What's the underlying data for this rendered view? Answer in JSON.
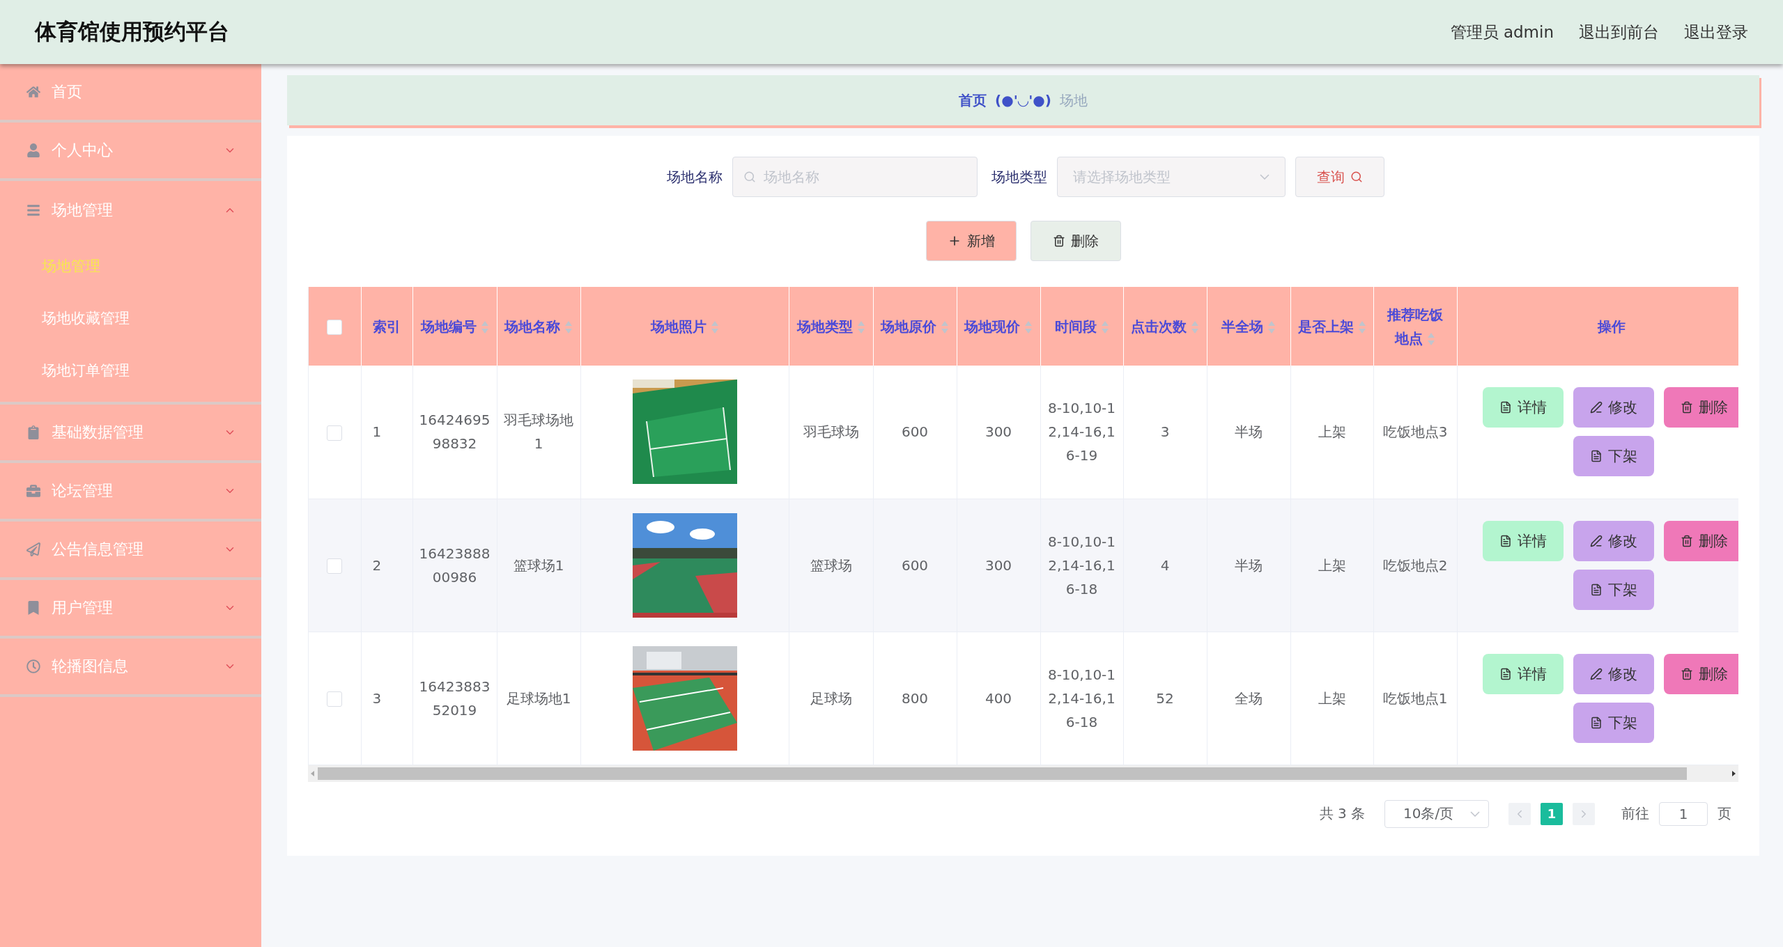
{
  "header": {
    "title": "体育馆使用预约平台",
    "user": "管理员 admin",
    "links": [
      "退出到前台",
      "退出登录"
    ]
  },
  "sidebar": {
    "items": [
      {
        "label": "首页",
        "expandable": false
      },
      {
        "label": "个人中心",
        "expandable": true,
        "expanded": false
      },
      {
        "label": "场地管理",
        "expandable": true,
        "expanded": true,
        "children": [
          {
            "label": "场地管理",
            "selected": true
          },
          {
            "label": "场地收藏管理",
            "selected": false
          },
          {
            "label": "场地订单管理",
            "selected": false
          }
        ]
      },
      {
        "label": "基础数据管理",
        "expandable": true,
        "expanded": false
      },
      {
        "label": "论坛管理",
        "expandable": true,
        "expanded": false
      },
      {
        "label": "公告信息管理",
        "expandable": true,
        "expanded": false
      },
      {
        "label": "用户管理",
        "expandable": true,
        "expanded": false
      },
      {
        "label": "轮播图信息",
        "expandable": true,
        "expanded": false
      }
    ]
  },
  "breadcrumb": {
    "home": "首页",
    "separator": "(●'◡'●)",
    "current": "场地"
  },
  "search": {
    "name_label": "场地名称",
    "name_placeholder": "场地名称",
    "type_label": "场地类型",
    "type_placeholder": "请选择场地类型",
    "query_button": "查询"
  },
  "actions": [
    {
      "kind": "add",
      "label": "新增"
    },
    {
      "kind": "delete",
      "label": "删除"
    }
  ],
  "table": {
    "select_all_checked": false,
    "columns": [
      {
        "label": "索引",
        "sortable": false
      },
      {
        "label": "场地编号",
        "sortable": true
      },
      {
        "label": "场地名称",
        "sortable": true
      },
      {
        "label": "场地照片",
        "sortable": true
      },
      {
        "label": "场地类型",
        "sortable": true
      },
      {
        "label": "场地原价",
        "sortable": true
      },
      {
        "label": "场地现价",
        "sortable": true
      },
      {
        "label": "时间段",
        "sortable": true
      },
      {
        "label": "点击次数",
        "sortable": true
      },
      {
        "label": "半全场",
        "sortable": true
      },
      {
        "label": "是否上架",
        "sortable": true
      },
      {
        "label": "推荐吃饭地点",
        "sortable": true
      },
      {
        "label": "操作",
        "sortable": false
      }
    ],
    "rows": [
      {
        "checked": false,
        "cells": [
          "1",
          "1642469598832",
          "羽毛球场地1",
          {
            "kind": "picture"
          },
          "羽毛球场",
          "600",
          "300",
          "8-10,10-12,14-16,16-19",
          "3",
          "半场",
          "上架",
          "吃饭地点3"
        ],
        "actions": [
          {
            "kind": "detail",
            "label": "详情"
          },
          {
            "kind": "edit",
            "label": "修改"
          },
          {
            "kind": "delete",
            "label": "删除"
          },
          {
            "kind": "unlist",
            "label": "下架"
          }
        ]
      },
      {
        "checked": false,
        "cells": [
          "2",
          "1642388800986",
          "篮球场1",
          {
            "kind": "picture"
          },
          "篮球场",
          "600",
          "300",
          "8-10,10-12,14-16,16-18",
          "4",
          "半场",
          "上架",
          "吃饭地点2"
        ],
        "actions": [
          {
            "kind": "detail",
            "label": "详情"
          },
          {
            "kind": "edit",
            "label": "修改"
          },
          {
            "kind": "delete",
            "label": "删除"
          },
          {
            "kind": "unlist",
            "label": "下架"
          }
        ]
      },
      {
        "checked": false,
        "cells": [
          "3",
          "1642388352019",
          "足球场地1",
          {
            "kind": "picture"
          },
          "足球场",
          "800",
          "400",
          "8-10,10-12,14-16,16-18",
          "52",
          "全场",
          "上架",
          "吃饭地点1"
        ],
        "actions": [
          {
            "kind": "detail",
            "label": "详情"
          },
          {
            "kind": "edit",
            "label": "修改"
          },
          {
            "kind": "delete",
            "label": "删除"
          },
          {
            "kind": "unlist",
            "label": "下架"
          }
        ]
      }
    ]
  },
  "pagination": {
    "total": "共 3 条",
    "page_size": "10条/页",
    "pages": [
      {
        "label": "1",
        "selected": true
      }
    ],
    "goto_label": "前往",
    "goto_value": "1",
    "goto_suffix": "页"
  }
}
